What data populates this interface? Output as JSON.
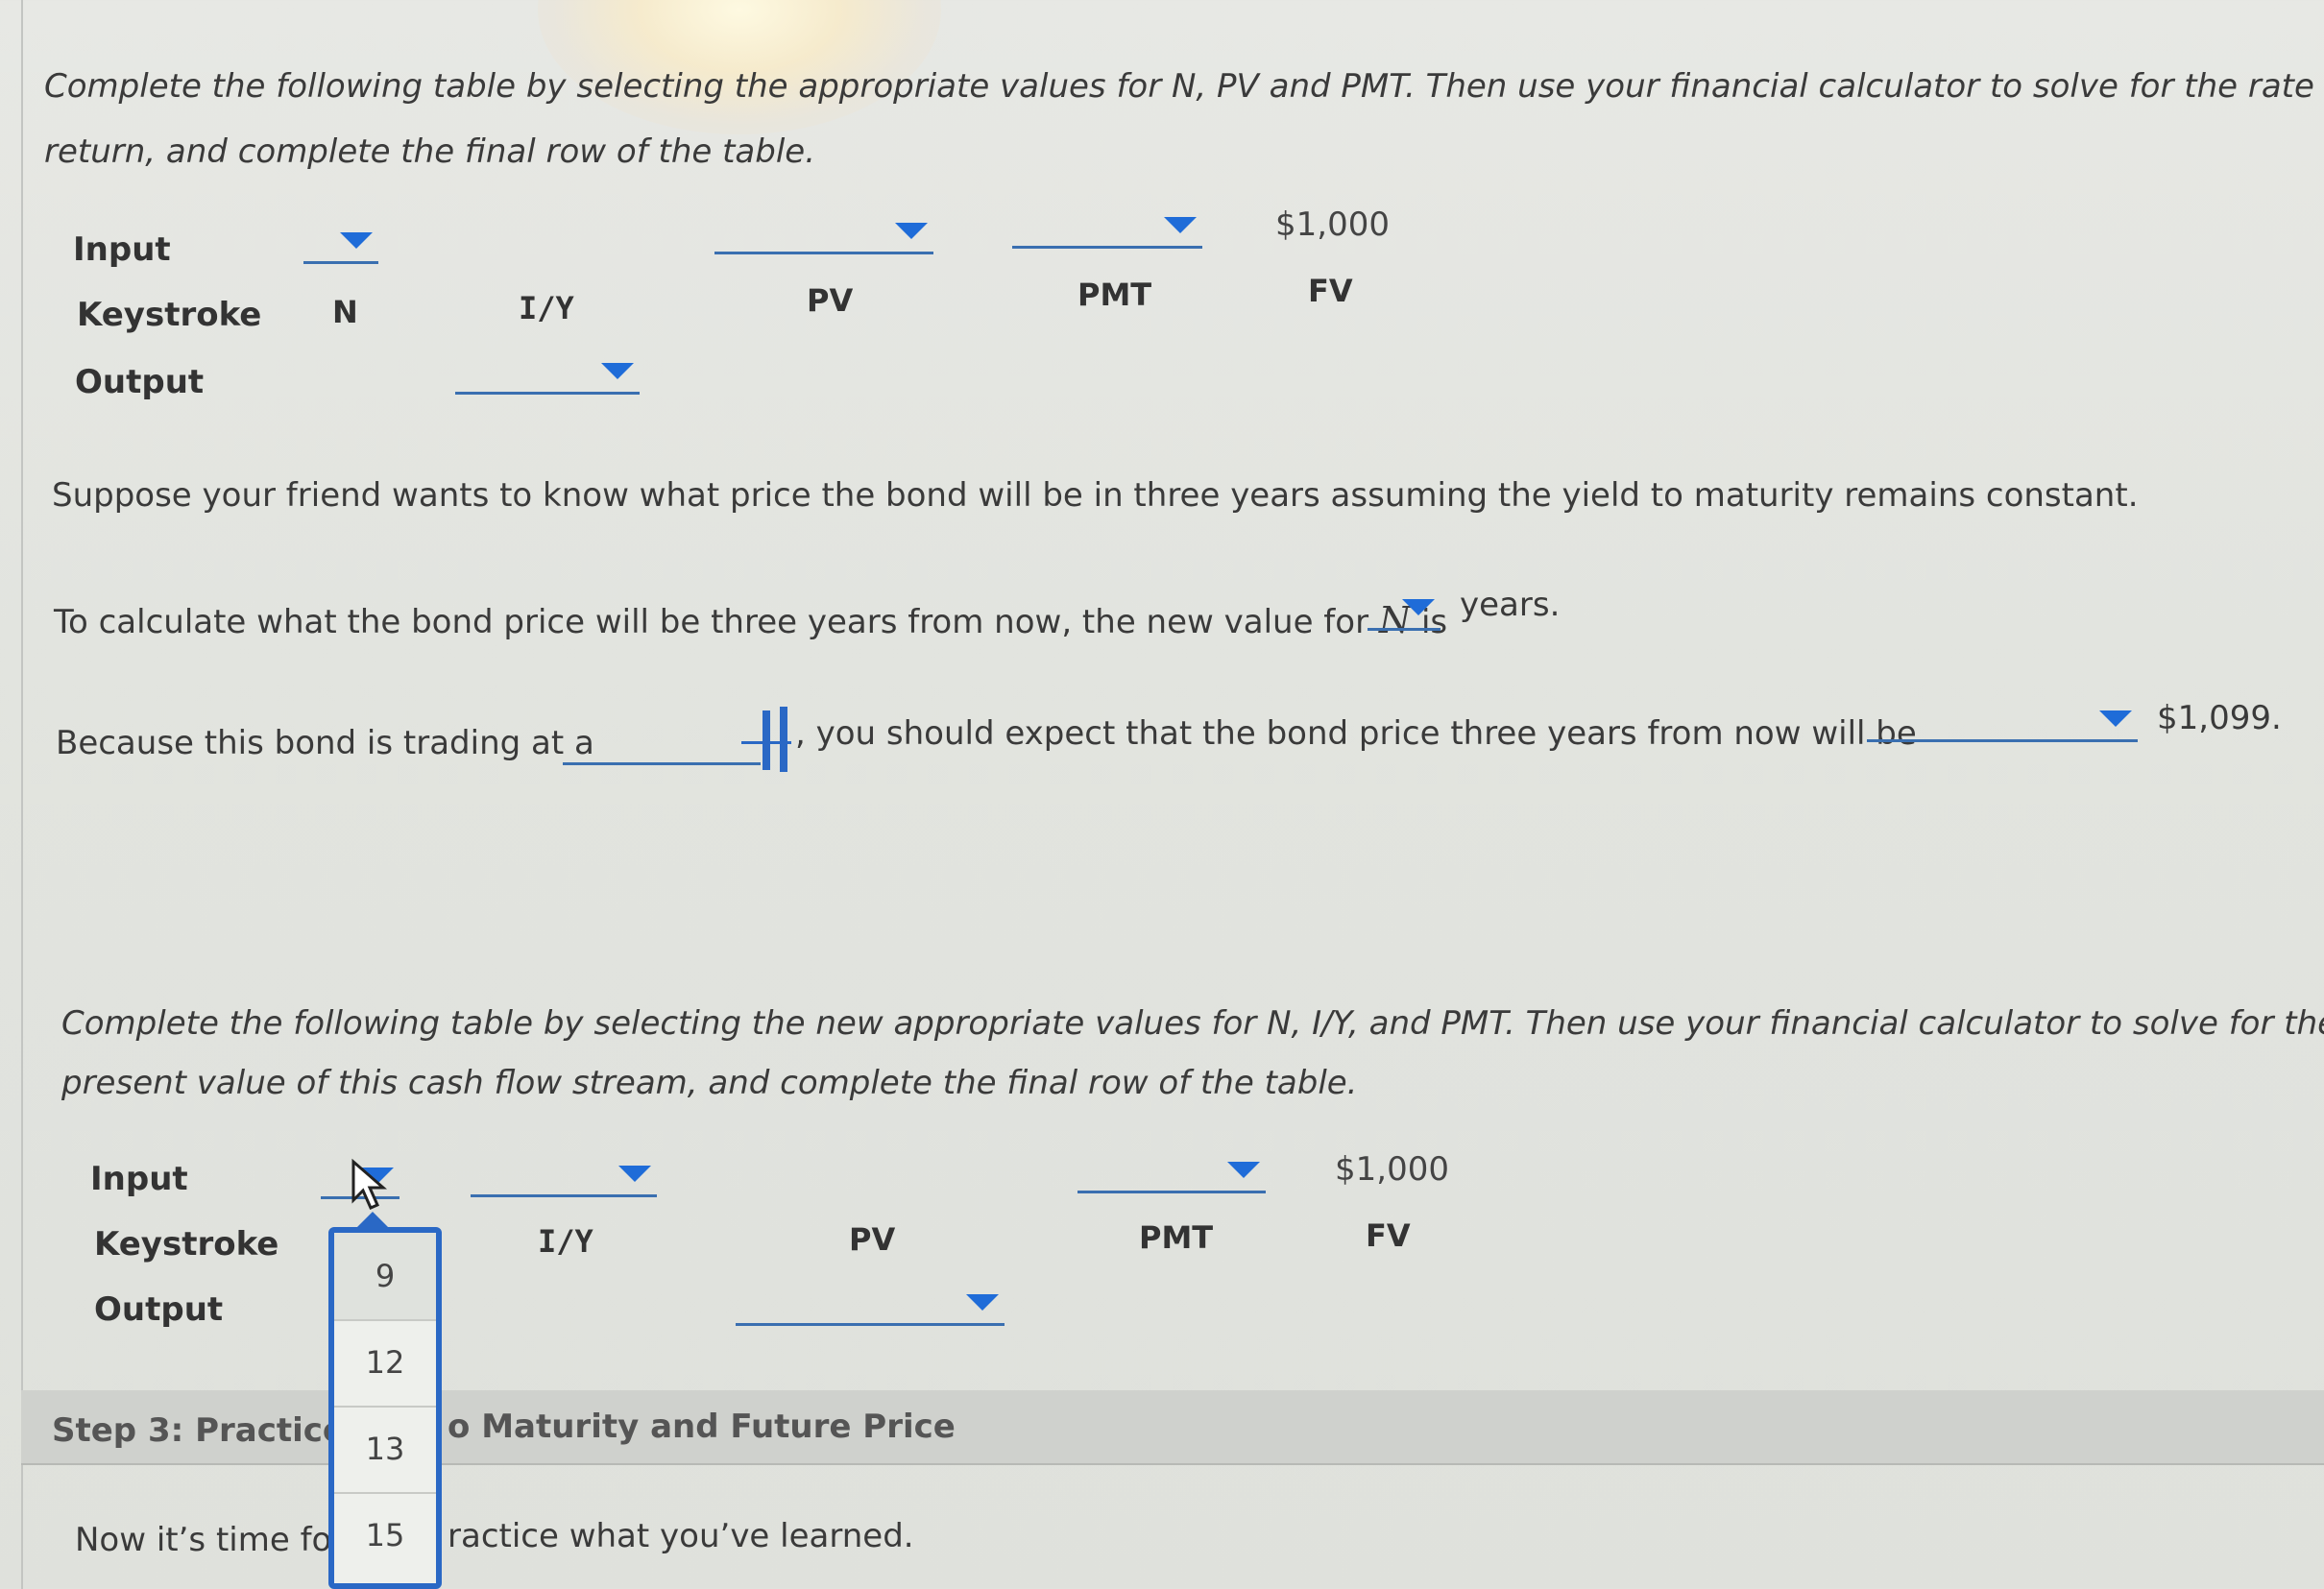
{
  "section1": {
    "instruction_line1": "Complete the following table by selecting the appropriate values for N, PV and PMT. Then use your financial calculator to solve for the rate of",
    "instruction_line2": "return, and complete the final row of the table.",
    "rows": {
      "input": "Input",
      "keystroke": "Keystroke",
      "output": "Output"
    },
    "keys": {
      "n": "N",
      "iy": "I/Y",
      "pv": "PV",
      "pmt": "PMT",
      "fv": "FV"
    },
    "fv_value": "$1,000"
  },
  "suppose_text": "Suppose your friend wants to know what price the bond will be in three years assuming the yield to maturity remains constant.",
  "new_n_text_before": "To calculate what the bond price will be three years from now, the new value for",
  "new_n_var": "N",
  "new_n_text_is": "is",
  "new_n_text_after": "years.",
  "trading_text_before": "Because this bond is trading at a",
  "trading_text_middle": ", you should expect that the bond price three years from now will be",
  "trading_value": "$1,099.",
  "section2": {
    "instruction_line1": "Complete the following table by selecting the new appropriate values for N, I/Y, and PMT. Then use your financial calculator to solve for the",
    "instruction_line2": "present value of this cash flow stream, and complete the final row of the table.",
    "rows": {
      "input": "Input",
      "keystroke": "Keystroke",
      "output": "Output"
    },
    "keys": {
      "iy": "I/Y",
      "pv": "PV",
      "pmt": "PMT",
      "fv": "FV"
    },
    "fv_value": "$1,000"
  },
  "dropdown_options": [
    "9",
    "12",
    "13",
    "15"
  ],
  "step3": {
    "label_left": "Step 3: Practice:",
    "label_right": "o Maturity and Future Price"
  },
  "footer": {
    "text_left": "Now it’s time for",
    "text_right": "ractice what you’ve learned."
  },
  "colors": {
    "accent": "#1f6cd8",
    "underline": "#3a6fb0",
    "text": "#333333"
  }
}
